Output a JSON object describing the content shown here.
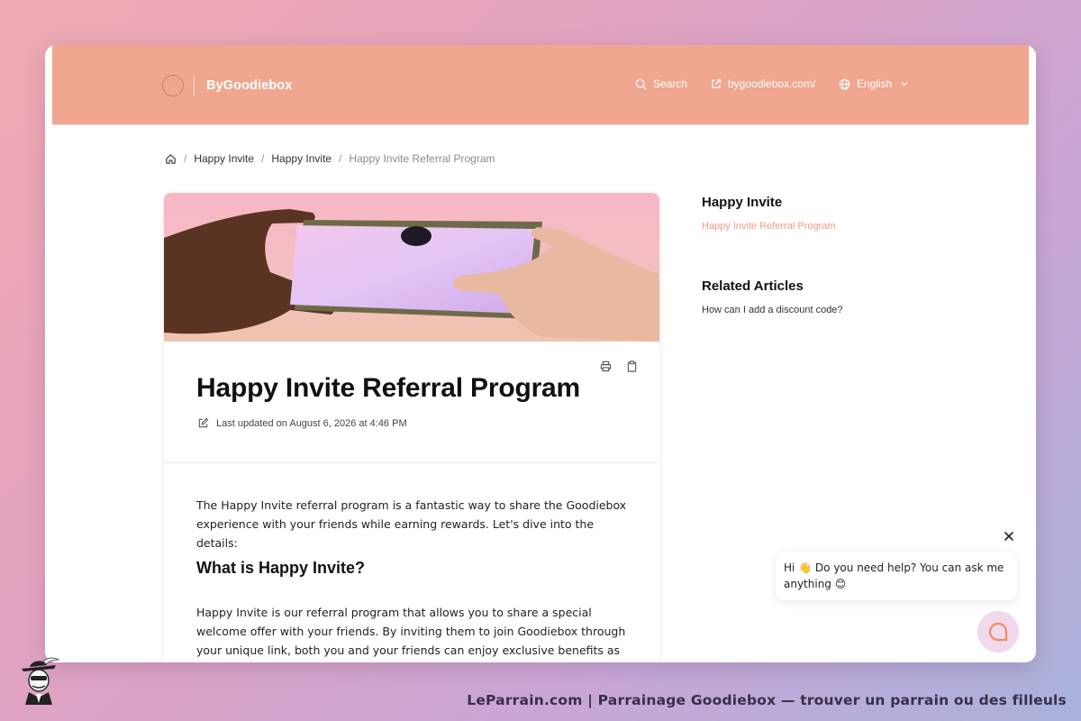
{
  "header": {
    "brand": "ByGoodiebox",
    "search_label": "Search",
    "site_link": "bygoodiebox.com/",
    "language": "English"
  },
  "breadcrumb": {
    "items": [
      "Happy Invite",
      "Happy Invite",
      "Happy Invite Referral Program"
    ]
  },
  "article": {
    "title": "Happy Invite Referral Program",
    "updated": "Last updated on August 6, 2026 at 4:46 PM",
    "intro": "The Happy Invite referral program is a fantastic way to share the Goodiebox experience with your friends while earning rewards. Let's dive into the details:",
    "heading": "What is Happy Invite?",
    "para": "Happy Invite is our referral program that allows you to share a special welcome offer with your friends. By inviting them to join Goodiebox through your unique link, both you and your friends can enjoy exclusive benefits as you will receive a free gift as a"
  },
  "sidebar": {
    "section_title": "Happy Invite",
    "section_link": "Happy Invite Referral Program",
    "related_title": "Related Articles",
    "related_link": "How can I add a discount code?"
  },
  "chat": {
    "message": "Hi 👋 Do you need help? You can ask me anything 😊"
  },
  "footer": {
    "caption": "LeParrain.com | Parrainage Goodiebox — trouver un parrain ou des filleuls"
  },
  "colors": {
    "header_bg": "#f0a68f",
    "accent_link": "#ee9a84",
    "chat_button_bg": "#f1d8ec"
  }
}
